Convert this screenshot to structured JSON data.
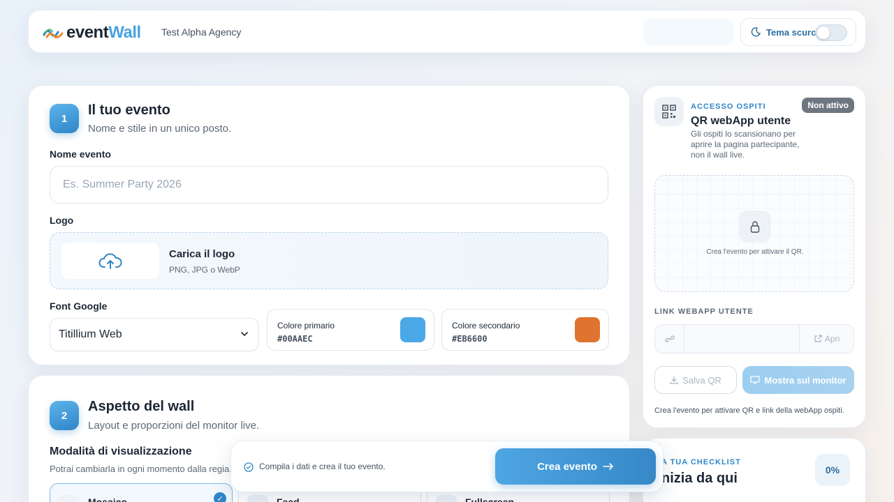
{
  "header": {
    "brand_event": "event",
    "brand_wall": "Wall",
    "agency": "Test Alpha Agency",
    "theme_label": "Tema scuro"
  },
  "step1": {
    "number": "1",
    "title": "Il tuo evento",
    "subtitle": "Nome e stile in un unico posto.",
    "name_label": "Nome evento",
    "name_placeholder": "Es. Summer Party 2026",
    "logo_label": "Logo",
    "upload_title": "Carica il logo",
    "upload_formats": "PNG, JPG o WebP",
    "font_label": "Font Google",
    "font_value": "Titillium Web",
    "primary_label": "Colore primario",
    "primary_hex": "#00AAEC",
    "secondary_label": "Colore secondario",
    "secondary_hex": "#EB6600"
  },
  "colors": {
    "primary_swatch": "#4aa8e6",
    "secondary_swatch": "#df7430"
  },
  "step2": {
    "number": "2",
    "title": "Aspetto del wall",
    "subtitle": "Layout e proporzioni del monitor live.",
    "mode_title": "Modalità di visualizzazione",
    "mode_subtitle": "Potrai cambiarla in ogni momento dalla regia.",
    "modes": [
      "Mosaico",
      "Feed",
      "Fullscreen"
    ]
  },
  "qr": {
    "kicker": "ACCESSO OSPITI",
    "badge": "Non attivo",
    "title": "QR webApp utente",
    "description": "Gli ospiti lo scansionano per aprire la pagina partecipante, non il wall live.",
    "placeholder_note": "Crea l'evento per attivare il QR.",
    "link_label": "LINK WEBAPP UTENTE",
    "open_label": "Apri",
    "save_label": "Salva QR",
    "monitor_label": "Mostra sul monitor",
    "footer_note": "Crea l'evento per attivare QR e link della webApp ospiti."
  },
  "checklist": {
    "kicker": "A TUA CHECKLIST",
    "title": "nizia da qui",
    "percent": "0%"
  },
  "floatbar": {
    "hint": "Compila i dati e crea il tuo evento.",
    "create_label": "Crea evento"
  }
}
